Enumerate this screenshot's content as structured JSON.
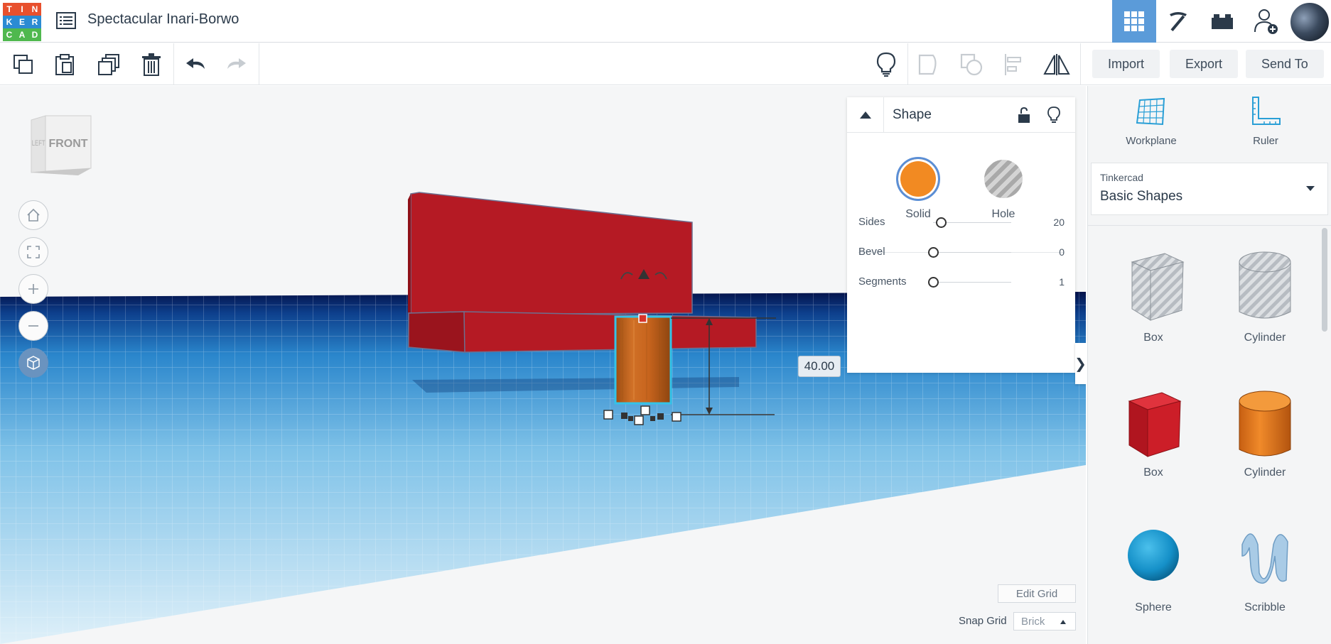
{
  "app": {
    "logo_letters": [
      "T",
      "I",
      "N",
      "K",
      "E",
      "R",
      "C",
      "A",
      "D"
    ],
    "logo_colors": [
      "#e8502d",
      "#e8502d",
      "#e8502d",
      "#2b8bd3",
      "#2b8bd3",
      "#2b8bd3",
      "#4fb84e",
      "#4fb84e",
      "#4fb84e"
    ],
    "design_title": "Spectacular Inari-Borwo"
  },
  "toolbar": {
    "import_label": "Import",
    "export_label": "Export",
    "send_to_label": "Send To"
  },
  "viewcube": {
    "front_label": "FRONT",
    "left_label": "LEFT"
  },
  "dimension": {
    "height_value": "40.00"
  },
  "inspector": {
    "title": "Shape",
    "solid_label": "Solid",
    "hole_label": "Hole",
    "solid_color": "#f28a22",
    "props": [
      {
        "name": "Sides",
        "value": "20",
        "level": 0.1
      },
      {
        "name": "Bevel",
        "value": "0",
        "level": 0
      },
      {
        "name": "Segments",
        "value": "1",
        "level": 0
      }
    ]
  },
  "grid": {
    "edit_grid_label": "Edit Grid",
    "snap_grid_label": "Snap Grid",
    "snap_grid_value": "Brick"
  },
  "panel": {
    "workplane_label": "Workplane",
    "ruler_label": "Ruler",
    "library_source": "Tinkercad",
    "library_name": "Basic Shapes",
    "shapes": [
      {
        "name": "Box"
      },
      {
        "name": "Cylinder"
      },
      {
        "name": "Box"
      },
      {
        "name": "Cylinder"
      },
      {
        "name": "Sphere"
      },
      {
        "name": "Scribble"
      }
    ]
  }
}
